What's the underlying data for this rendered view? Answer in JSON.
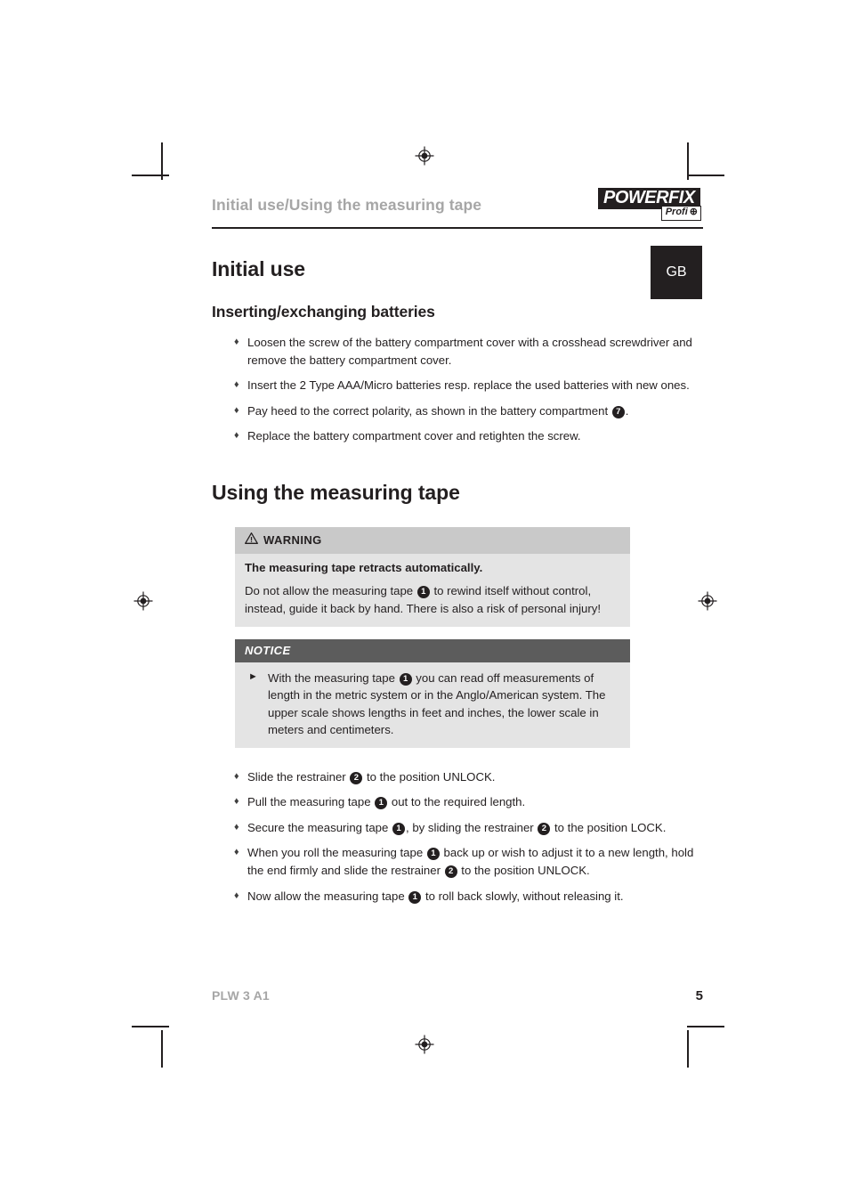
{
  "header": {
    "running_title": "Initial use/Using the measuring tape",
    "logo_main": "POWERFIX",
    "logo_trademark": "˙",
    "logo_sub": "Profi",
    "logo_sub_mark": "⊕"
  },
  "language_tab": "GB",
  "sections": [
    {
      "h1": "Initial use",
      "h2": "Inserting/exchanging batteries",
      "bullets": [
        {
          "parts": [
            {
              "type": "text",
              "value": "Loosen the screw of the battery compartment cover with a crosshead screwdriver and remove the battery compartment cover."
            }
          ]
        },
        {
          "parts": [
            {
              "type": "text",
              "value": "Insert the 2 Type AAA/Micro batteries resp. replace the used batteries with new ones."
            }
          ]
        },
        {
          "parts": [
            {
              "type": "text",
              "value": "Pay heed to the correct polarity, as shown in the battery compartment "
            },
            {
              "type": "callout",
              "value": "7"
            },
            {
              "type": "text",
              "value": "."
            }
          ]
        },
        {
          "parts": [
            {
              "type": "text",
              "value": "Replace the battery compartment cover and retighten the screw."
            }
          ]
        }
      ]
    }
  ],
  "second_section": {
    "h1": "Using the measuring tape",
    "warning": {
      "icon": "warning-triangle-icon",
      "label": "WARNING",
      "strong_line": "The measuring tape retracts automatically.",
      "body_parts": [
        {
          "type": "text",
          "value": "Do not allow the measuring tape "
        },
        {
          "type": "callout",
          "value": "1"
        },
        {
          "type": "text",
          "value": " to rewind itself without control, instead, guide it back by hand. There is also a risk of personal injury!"
        }
      ]
    },
    "notice": {
      "label": "NOTICE",
      "arrow": "►",
      "body_parts": [
        {
          "type": "text",
          "value": "With the measuring tape "
        },
        {
          "type": "callout",
          "value": "1"
        },
        {
          "type": "text",
          "value": " you can read off measurements of length in the metric system or in the Anglo/American system. The upper scale shows lengths in feet and inches, the lower scale in meters and centimeters."
        }
      ]
    },
    "bullets": [
      {
        "parts": [
          {
            "type": "text",
            "value": "Slide the restrainer "
          },
          {
            "type": "callout",
            "value": "2"
          },
          {
            "type": "text",
            "value": " to the position UNLOCK."
          }
        ]
      },
      {
        "parts": [
          {
            "type": "text",
            "value": "Pull the measuring tape "
          },
          {
            "type": "callout",
            "value": "1"
          },
          {
            "type": "text",
            "value": " out to the required length."
          }
        ]
      },
      {
        "parts": [
          {
            "type": "text",
            "value": "Secure the measuring tape "
          },
          {
            "type": "callout",
            "value": "1"
          },
          {
            "type": "text",
            "value": ", by sliding the restrainer "
          },
          {
            "type": "callout",
            "value": "2"
          },
          {
            "type": "text",
            "value": " to the position LOCK."
          }
        ]
      },
      {
        "parts": [
          {
            "type": "text",
            "value": "When you roll the measuring tape "
          },
          {
            "type": "callout",
            "value": "1"
          },
          {
            "type": "text",
            "value": " back up or wish to adjust it to a new length, hold the end firmly and slide the restrainer "
          },
          {
            "type": "callout",
            "value": "2"
          },
          {
            "type": "text",
            "value": " to the position UNLOCK."
          }
        ]
      },
      {
        "parts": [
          {
            "type": "text",
            "value": "Now allow the measuring tape "
          },
          {
            "type": "callout",
            "value": "1"
          },
          {
            "type": "text",
            "value": " to roll back slowly, without releasing it."
          }
        ]
      }
    ]
  },
  "bullet_glyph": "♦",
  "footer": {
    "model": "PLW 3 A1",
    "page_number": "5"
  },
  "colors": {
    "ink": "#231f20",
    "muted": "#a6a6a6",
    "warn_header_bg": "#c9c9c9",
    "box_body_bg": "#e4e4e4",
    "notice_header_bg": "#5c5c5c"
  }
}
